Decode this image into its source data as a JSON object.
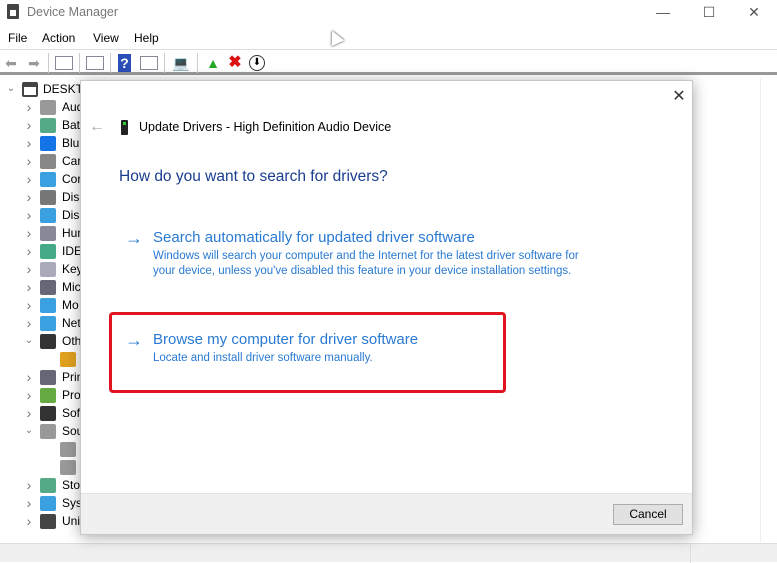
{
  "window": {
    "title": "Device Manager",
    "controls": [
      "minimize",
      "maximize",
      "close"
    ]
  },
  "menu": [
    "File",
    "Action",
    "View",
    "Help"
  ],
  "toolbar": {
    "icons": [
      "back-arrow-icon",
      "forward-arrow-icon",
      "properties-pane-icon",
      "list-icon",
      "help-icon",
      "show-pane-icon",
      "scan-hardware-icon",
      "update-driver-icon",
      "uninstall-icon",
      "disable-device-icon"
    ]
  },
  "tree": {
    "root": "DESKTO",
    "items": [
      {
        "label": "Aud",
        "expanded": false,
        "color": "#999"
      },
      {
        "label": "Bat",
        "expanded": false,
        "color": "#5a8"
      },
      {
        "label": "Blu",
        "expanded": false,
        "color": "#1473e6"
      },
      {
        "label": "Car",
        "expanded": false,
        "color": "#888"
      },
      {
        "label": "Cor",
        "expanded": false,
        "color": "#3aa0e0"
      },
      {
        "label": "Disl",
        "expanded": false,
        "color": "#777"
      },
      {
        "label": "Disp",
        "expanded": false,
        "color": "#3aa0e0"
      },
      {
        "label": "Hun",
        "expanded": false,
        "color": "#889"
      },
      {
        "label": "IDE",
        "expanded": false,
        "color": "#4a8"
      },
      {
        "label": "Key",
        "expanded": false,
        "color": "#aab"
      },
      {
        "label": "Mic",
        "expanded": false,
        "color": "#667"
      },
      {
        "label": "Mo",
        "expanded": false,
        "color": "#3aa0e0"
      },
      {
        "label": "Net",
        "expanded": false,
        "color": "#3aa0e0"
      },
      {
        "label": "Oth",
        "expanded": true,
        "color": "#333"
      },
      {
        "label": "",
        "child": true,
        "color": "#e0a020"
      },
      {
        "label": "Prin",
        "expanded": false,
        "color": "#667"
      },
      {
        "label": "Pro",
        "expanded": false,
        "color": "#6a4"
      },
      {
        "label": "Sof",
        "expanded": false,
        "color": "#333"
      },
      {
        "label": "Sou",
        "expanded": true,
        "color": "#999"
      },
      {
        "label": "",
        "child": true,
        "color": "#999"
      },
      {
        "label": "",
        "child": true,
        "color": "#999"
      },
      {
        "label": "Sto",
        "expanded": false,
        "color": "#5a8"
      },
      {
        "label": "Syst",
        "expanded": false,
        "color": "#3aa0e0"
      },
      {
        "label": "Uni",
        "expanded": false,
        "color": "#444"
      }
    ]
  },
  "dialog": {
    "header": "Update Drivers - High Definition Audio Device",
    "question": "How do you want to search for drivers?",
    "options": [
      {
        "title": "Search automatically for updated driver software",
        "desc": "Windows will search your computer and the Internet for the latest driver software for your device, unless you've disabled this feature in your device installation settings."
      },
      {
        "title": "Browse my computer for driver software",
        "desc": "Locate and install driver software manually.",
        "highlighted": true
      }
    ],
    "cancel": "Cancel",
    "accent": "#2a7ad2",
    "highlight_color": "#e0141e"
  }
}
